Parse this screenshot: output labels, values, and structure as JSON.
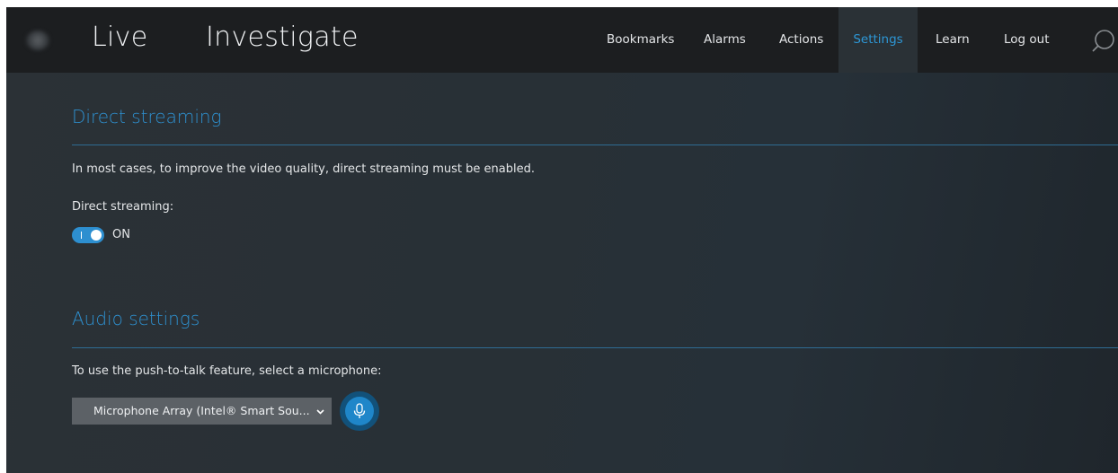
{
  "header": {
    "tabs": [
      {
        "label": "Live"
      },
      {
        "label": "Investigate"
      }
    ],
    "nav": [
      {
        "label": "Bookmarks"
      },
      {
        "label": "Alarms"
      },
      {
        "label": "Actions"
      },
      {
        "label": "Settings",
        "active": true
      },
      {
        "label": "Learn"
      },
      {
        "label": "Log out"
      }
    ],
    "search_icon": "search-icon"
  },
  "direct_streaming": {
    "title": "Direct streaming",
    "description": "In most cases, to improve the video quality, direct streaming must be enabled.",
    "field_label": "Direct streaming:",
    "toggle_state": "ON",
    "enabled": true
  },
  "audio_settings": {
    "title": "Audio settings",
    "description": "To use the push-to-talk feature, select a microphone:",
    "microphone_selected": "Microphone Array (Intel® Smart Sou...",
    "mic_icon": "microphone-icon"
  },
  "colors": {
    "accent": "#2d97d6",
    "topbar": "#1c1e20",
    "background": "#283036",
    "select_bg": "#5c6166",
    "mic_button": "#1f86c9"
  }
}
